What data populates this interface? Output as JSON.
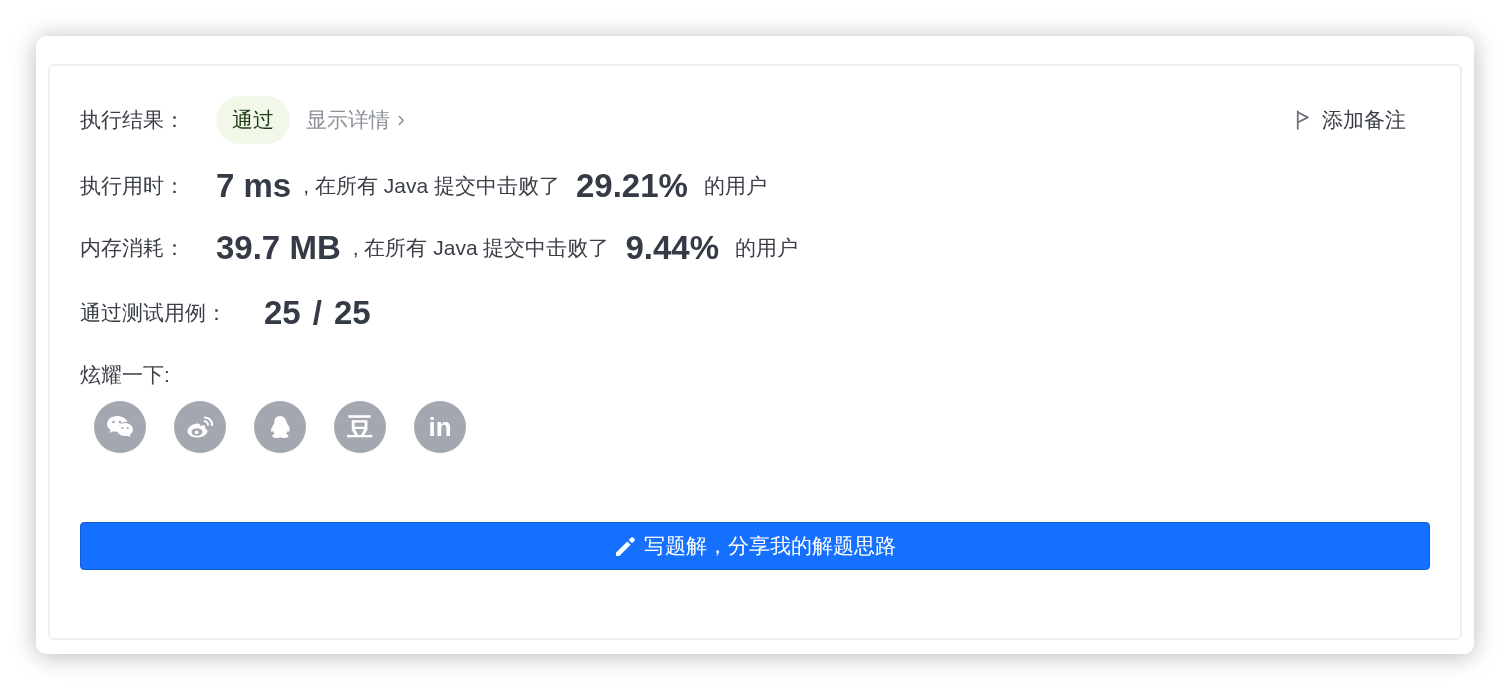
{
  "result": {
    "label": "执行结果：",
    "status": "通过",
    "details_link": "显示详情"
  },
  "note_button": "添加备注",
  "stats": [
    {
      "label": "执行用时：",
      "value": "7 ms",
      "text": ", 在所有 Java 提交中击败了",
      "percent": "29.21%",
      "suffix": "的用户"
    },
    {
      "label": "内存消耗：",
      "value": "39.7 MB",
      "text": ", 在所有 Java 提交中击败了",
      "percent": "9.44%",
      "suffix": "的用户"
    }
  ],
  "test_cases": {
    "label": "通过测试用例：",
    "passed": "25",
    "separator": "/",
    "total": "25"
  },
  "share": {
    "label": "炫耀一下:",
    "buttons": [
      {
        "kind": "chat"
      },
      {
        "kind": "eye"
      },
      {
        "kind": "penguin"
      },
      {
        "kind": "glyph",
        "glyph": "豆"
      },
      {
        "kind": "glyph",
        "glyph": "in"
      }
    ]
  },
  "write_button": "写题解，分享我的解题思路"
}
